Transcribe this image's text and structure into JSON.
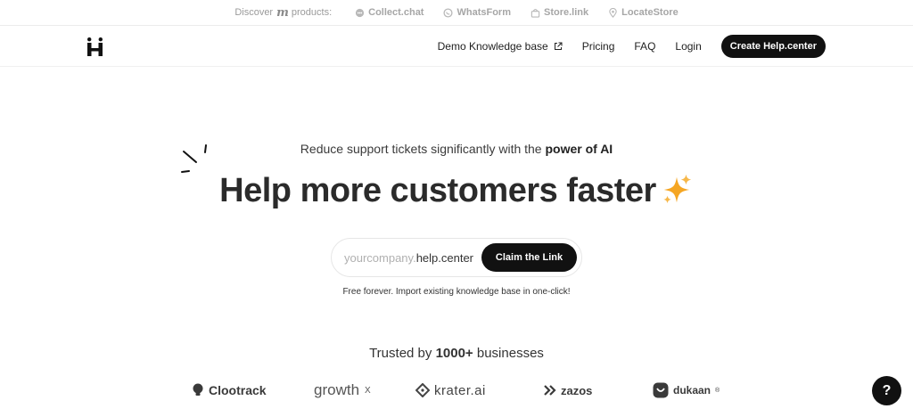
{
  "topbar": {
    "discover_prefix": "Discover",
    "discover_logo": "m",
    "discover_suffix": "products:",
    "products": [
      {
        "label": "Collect.chat",
        "icon": "chat-bubble-icon"
      },
      {
        "label": "WhatsForm",
        "icon": "whatsapp-icon"
      },
      {
        "label": "Store.link",
        "icon": "shop-bag-icon"
      },
      {
        "label": "LocateStore",
        "icon": "location-pin-icon"
      }
    ]
  },
  "nav": {
    "brand_icon": "h-letter-logo",
    "links": [
      {
        "label": "Demo Knowledge base",
        "icon": "external-link-icon"
      },
      {
        "label": "Pricing"
      },
      {
        "label": "FAQ"
      },
      {
        "label": "Login"
      }
    ],
    "cta_label": "Create Help.center"
  },
  "hero": {
    "tagline_prefix": "Reduce support tickets significantly with the",
    "tagline_bold": "power of AI",
    "headline": "Help more customers faster",
    "claim": {
      "domain_prefix": "yourcompany.",
      "domain_suffix": "help.center",
      "button_label": "Claim the Link"
    },
    "note": "Free forever. Import existing knowledge base in one-click!"
  },
  "trusted": {
    "prefix": "Trusted by",
    "bold": "1000+",
    "suffix": "businesses",
    "logos": [
      {
        "name": "Clootrack"
      },
      {
        "name": "growth",
        "superscript": "X"
      },
      {
        "name": "krater.ai"
      },
      {
        "name": "zazos"
      },
      {
        "name": "dukaan",
        "superscript": "®"
      }
    ]
  },
  "help_button": "?",
  "colors": {
    "primary": "#111111",
    "accent_star": "#f5a623"
  }
}
